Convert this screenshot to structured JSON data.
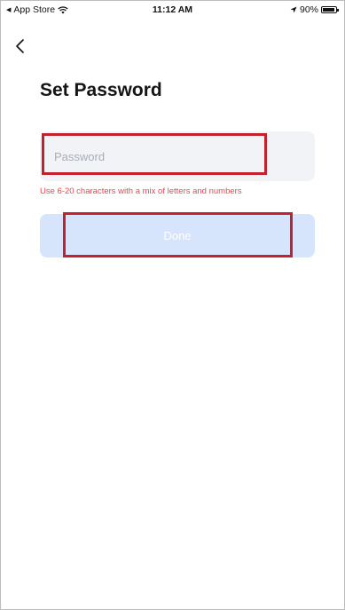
{
  "status_bar": {
    "back_app": "App Store",
    "time": "11:12 AM",
    "battery": "90%",
    "battery_level": 0.9
  },
  "nav": {
    "back_icon": "chevron-left-icon"
  },
  "page": {
    "title": "Set Password"
  },
  "password_field": {
    "value": "",
    "placeholder": "Password",
    "hint": "Use 6-20 characters with a mix of letters and numbers"
  },
  "done_button": {
    "label": "Done",
    "enabled": false
  },
  "colors": {
    "accent_disabled": "#d6e4fc",
    "hint_red": "#e5484d",
    "highlight_red": "#c4212f",
    "field_bg": "#f1f3f7"
  }
}
